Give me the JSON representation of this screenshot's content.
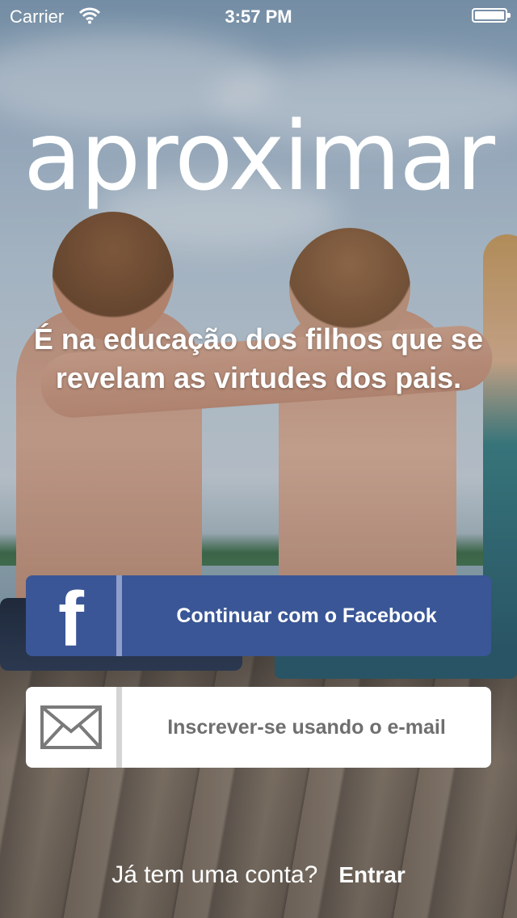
{
  "status_bar": {
    "carrier": "Carrier",
    "time": "3:57 PM"
  },
  "app": {
    "logo": "aproximar"
  },
  "tagline": "É na educação dos filhos que se revelam as virtudes dos pais.",
  "buttons": {
    "facebook": {
      "label": "Continuar com o Facebook",
      "icon": "facebook-f-icon",
      "color": "#3a5696"
    },
    "email": {
      "label": "Inscrever-se usando o e-mail",
      "icon": "envelope-icon"
    }
  },
  "footer": {
    "question": "Já tem uma conta?",
    "login_label": "Entrar"
  }
}
